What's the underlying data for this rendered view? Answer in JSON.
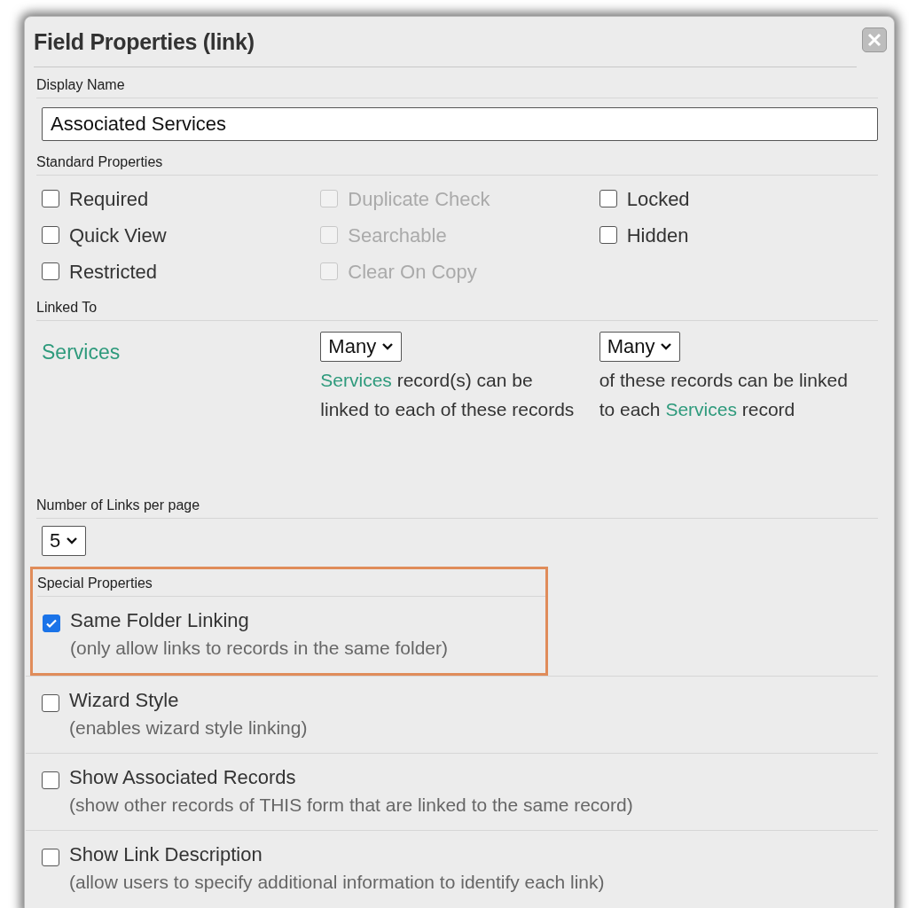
{
  "title": "Field Properties (link)",
  "display_name": {
    "label": "Display Name",
    "value": "Associated Services"
  },
  "standard_properties": {
    "label": "Standard Properties",
    "items": [
      {
        "label": "Required",
        "checked": false,
        "disabled": false
      },
      {
        "label": "Duplicate Check",
        "checked": false,
        "disabled": true
      },
      {
        "label": "Locked",
        "checked": false,
        "disabled": false
      },
      {
        "label": "Quick View",
        "checked": false,
        "disabled": false
      },
      {
        "label": "Searchable",
        "checked": false,
        "disabled": true
      },
      {
        "label": "Hidden",
        "checked": false,
        "disabled": false
      },
      {
        "label": "Restricted",
        "checked": false,
        "disabled": false
      },
      {
        "label": "Clear On Copy",
        "checked": false,
        "disabled": true
      }
    ]
  },
  "linked_to": {
    "label": "Linked To",
    "form": "Services",
    "relations": [
      {
        "select": "Many",
        "description": [
          {
            "kind": "link",
            "text": "Services"
          },
          {
            "kind": "text",
            "text": " record(s) can be linked to each of these records"
          }
        ]
      },
      {
        "select": "Many",
        "description": [
          {
            "kind": "text",
            "text": "of these records can be linked to each "
          },
          {
            "kind": "link",
            "text": "Services"
          },
          {
            "kind": "text",
            "text": " record"
          }
        ]
      }
    ]
  },
  "links_per_page": {
    "label": "Number of Links per page",
    "select": "5"
  },
  "special_properties": {
    "label": "Special Properties",
    "items": [
      {
        "label": "Same Folder Linking",
        "note": "(only allow links to records in the same folder)",
        "checked": true,
        "highlighted": true
      },
      {
        "label": "Wizard Style",
        "note": "(enables wizard style linking)",
        "checked": false,
        "highlighted": false
      },
      {
        "label": "Show Associated Records",
        "note": "(show other records of THIS form that are linked to the same record)",
        "checked": false,
        "highlighted": false
      },
      {
        "label": "Show Link Description",
        "note": "(allow users to specify additional information to identify each link)",
        "checked": false,
        "highlighted": false
      }
    ]
  }
}
